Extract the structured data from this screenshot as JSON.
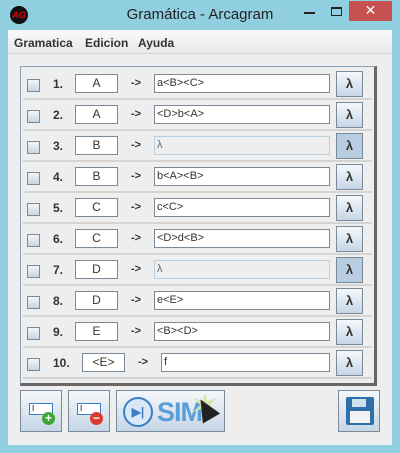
{
  "window": {
    "title": "Gramática - Arcagram",
    "logo_text": "AG",
    "close": "✕"
  },
  "menu": [
    "Gramatica",
    "Edicion",
    "Ayuda"
  ],
  "arrow": "->",
  "lambda": "λ",
  "rules": [
    {
      "num": "1.",
      "lhs": "A",
      "rhs": "a<B><C>",
      "lambda_active": false
    },
    {
      "num": "2.",
      "lhs": "A",
      "rhs": "<D>b<A>",
      "lambda_active": false
    },
    {
      "num": "3.",
      "lhs": "B",
      "rhs": "λ",
      "lambda_active": true
    },
    {
      "num": "4.",
      "lhs": "B",
      "rhs": "b<A><B>",
      "lambda_active": false
    },
    {
      "num": "5.",
      "lhs": "C",
      "rhs": "c<C>",
      "lambda_active": false
    },
    {
      "num": "6.",
      "lhs": "C",
      "rhs": "<D>d<B>",
      "lambda_active": false
    },
    {
      "num": "7.",
      "lhs": "D",
      "rhs": "λ",
      "lambda_active": true
    },
    {
      "num": "8.",
      "lhs": "D",
      "rhs": "e<E>",
      "lambda_active": false
    },
    {
      "num": "9.",
      "lhs": "E",
      "rhs": "<B><D>",
      "lambda_active": false
    },
    {
      "num": "10.",
      "lhs": "<E>",
      "rhs": "f",
      "lambda_active": false
    }
  ],
  "toolbar": {
    "add_icon": "add-rule-icon",
    "remove_icon": "remove-rule-icon",
    "sim_label": "SIM",
    "save_icon": "floppy-disk-icon"
  }
}
